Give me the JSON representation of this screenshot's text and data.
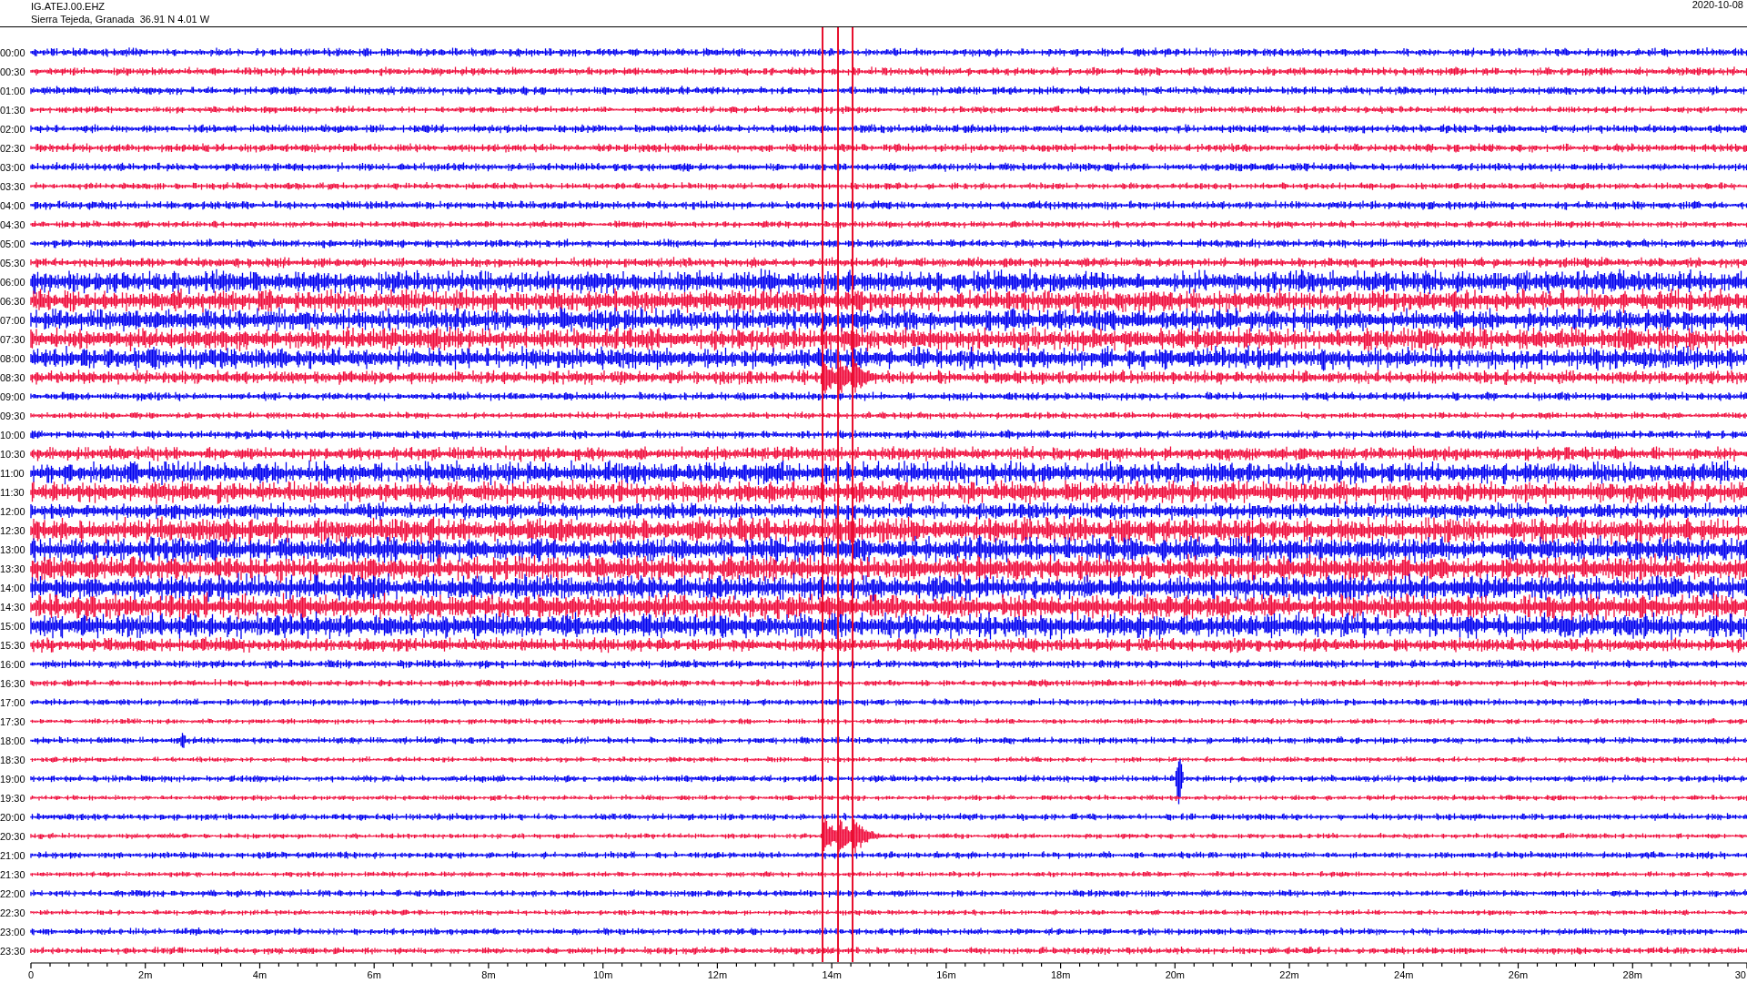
{
  "header": {
    "station": "IG.ATEJ.00.EHZ",
    "location": "Sierra Tejeda, Granada  36.91 N 4.01 W",
    "date": "2020-10-08"
  },
  "helicorder": {
    "rows": [
      {
        "time": "00:00",
        "color": "#0000f0"
      },
      {
        "time": "00:30",
        "color": "#f00c3c"
      },
      {
        "time": "01:00",
        "color": "#0000f0"
      },
      {
        "time": "01:30",
        "color": "#f00c3c"
      },
      {
        "time": "02:00",
        "color": "#0000f0"
      },
      {
        "time": "02:30",
        "color": "#f00c3c"
      },
      {
        "time": "03:00",
        "color": "#0000f0"
      },
      {
        "time": "03:30",
        "color": "#f00c3c"
      },
      {
        "time": "04:00",
        "color": "#0000f0"
      },
      {
        "time": "04:30",
        "color": "#f00c3c"
      },
      {
        "time": "05:00",
        "color": "#0000f0"
      },
      {
        "time": "05:30",
        "color": "#f00c3c"
      },
      {
        "time": "06:00",
        "color": "#0000f0"
      },
      {
        "time": "06:30",
        "color": "#f00c3c"
      },
      {
        "time": "07:00",
        "color": "#0000f0"
      },
      {
        "time": "07:30",
        "color": "#f00c3c"
      },
      {
        "time": "08:00",
        "color": "#0000f0"
      },
      {
        "time": "08:30",
        "color": "#f00c3c"
      },
      {
        "time": "09:00",
        "color": "#0000f0"
      },
      {
        "time": "09:30",
        "color": "#f00c3c"
      },
      {
        "time": "10:00",
        "color": "#0000f0"
      },
      {
        "time": "10:30",
        "color": "#f00c3c"
      },
      {
        "time": "11:00",
        "color": "#0000f0"
      },
      {
        "time": "11:30",
        "color": "#f00c3c"
      },
      {
        "time": "12:00",
        "color": "#0000f0"
      },
      {
        "time": "12:30",
        "color": "#f00c3c"
      },
      {
        "time": "13:00",
        "color": "#0000f0"
      },
      {
        "time": "13:30",
        "color": "#f00c3c"
      },
      {
        "time": "14:00",
        "color": "#0000f0"
      },
      {
        "time": "14:30",
        "color": "#f00c3c"
      },
      {
        "time": "15:00",
        "color": "#0000f0"
      },
      {
        "time": "15:30",
        "color": "#f00c3c"
      },
      {
        "time": "16:00",
        "color": "#0000f0"
      },
      {
        "time": "16:30",
        "color": "#f00c3c"
      },
      {
        "time": "17:00",
        "color": "#0000f0"
      },
      {
        "time": "17:30",
        "color": "#f00c3c"
      },
      {
        "time": "18:00",
        "color": "#0000f0"
      },
      {
        "time": "18:30",
        "color": "#f00c3c"
      },
      {
        "time": "19:00",
        "color": "#0000f0"
      },
      {
        "time": "19:30",
        "color": "#f00c3c"
      },
      {
        "time": "20:00",
        "color": "#0000f0"
      },
      {
        "time": "20:30",
        "color": "#f00c3c"
      },
      {
        "time": "21:00",
        "color": "#0000f0"
      },
      {
        "time": "21:30",
        "color": "#f00c3c"
      },
      {
        "time": "22:00",
        "color": "#0000f0"
      },
      {
        "time": "22:30",
        "color": "#f00c3c"
      },
      {
        "time": "23:00",
        "color": "#0000f0"
      },
      {
        "time": "23:30",
        "color": "#f00c3c"
      }
    ],
    "axis_labels": [
      "0",
      "2m",
      "4m",
      "6m",
      "8m",
      "10m",
      "12m",
      "14m",
      "16m",
      "18m",
      "20m",
      "22m",
      "24m",
      "26m",
      "28m",
      "30"
    ]
  }
}
